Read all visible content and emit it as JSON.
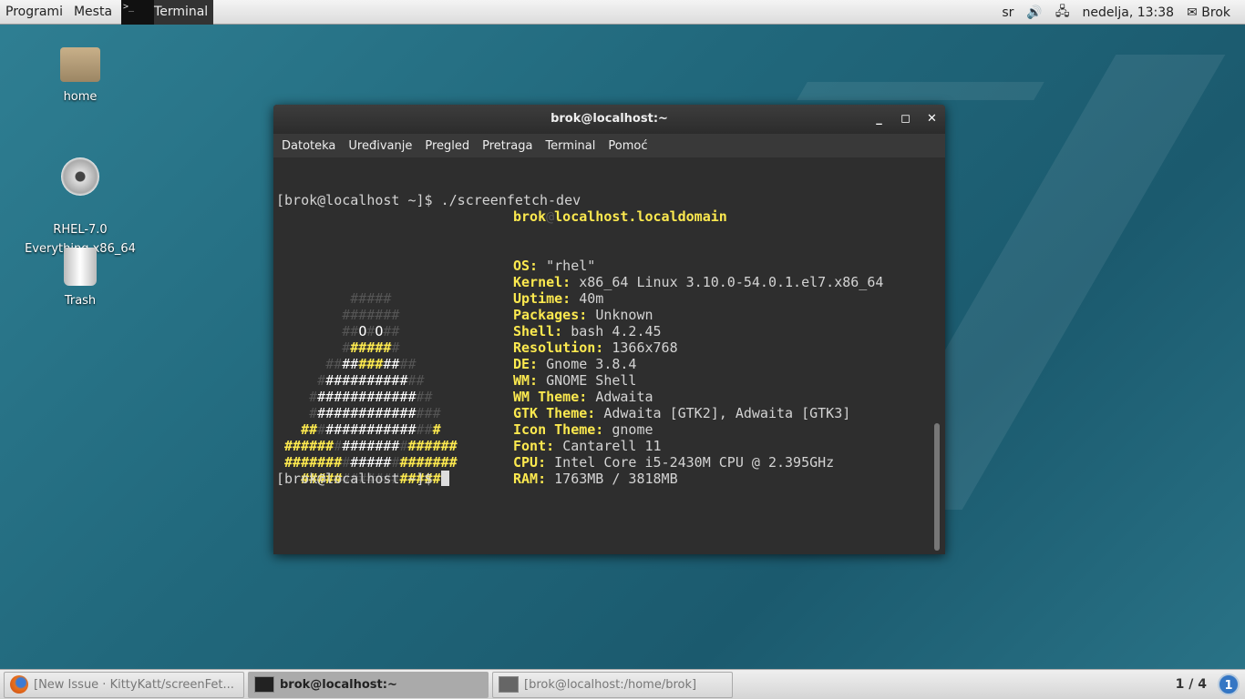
{
  "topbar": {
    "applications": "Programi",
    "places": "Mesta",
    "active_app": "Terminal",
    "keyboard": "sr",
    "clock": "nedelja, 13:38",
    "user": "Brok"
  },
  "desktop": [
    {
      "label": "home"
    },
    {
      "label": "RHEL-7.0\nEverything.x86_64"
    },
    {
      "label": "Trash"
    }
  ],
  "window": {
    "title": "brok@localhost:~",
    "menu": [
      "Datoteka",
      "Uređivanje",
      "Pregled",
      "Pretraga",
      "Terminal",
      "Pomoć"
    ],
    "command_line": "[brok@localhost ~]$ ./screenfetch-dev",
    "prompt": "[brok@localhost ~]$ ",
    "user": "brok",
    "host": "localhost.localdomain",
    "info": [
      [
        "OS:",
        "\"rhel\""
      ],
      [
        "Kernel:",
        "x86_64 Linux 3.10.0-54.0.1.el7.x86_64"
      ],
      [
        "Uptime:",
        "40m"
      ],
      [
        "Packages:",
        "Unknown"
      ],
      [
        "Shell:",
        "bash 4.2.45"
      ],
      [
        "Resolution:",
        "1366x768"
      ],
      [
        "DE:",
        "Gnome 3.8.4"
      ],
      [
        "WM:",
        "GNOME Shell"
      ],
      [
        "WM Theme:",
        "Adwaita"
      ],
      [
        "GTK Theme:",
        "Adwaita [GTK2], Adwaita [GTK3]"
      ],
      [
        "Icon Theme:",
        "gnome"
      ],
      [
        "Font:",
        "Cantarell 11"
      ],
      [
        "CPU:",
        "Intel Core i5-2430M CPU @ 2.395GHz"
      ],
      [
        "RAM:",
        "1763MB / 3818MB"
      ]
    ],
    "ascii": [
      [
        [
          "s",
          "         "
        ],
        [
          "d",
          "#####"
        ]
      ],
      [
        [
          "s",
          "        "
        ],
        [
          "d",
          "#######"
        ]
      ],
      [
        [
          "s",
          "        "
        ],
        [
          "d",
          "##"
        ],
        [
          "w",
          "O"
        ],
        [
          "d",
          "#"
        ],
        [
          "w",
          "O"
        ],
        [
          "d",
          "##"
        ]
      ],
      [
        [
          "s",
          "        "
        ],
        [
          "d",
          "#"
        ],
        [
          "y",
          "#####"
        ],
        [
          "d",
          "#"
        ]
      ],
      [
        [
          "s",
          "      "
        ],
        [
          "d",
          "##"
        ],
        [
          "w",
          "##"
        ],
        [
          "y",
          "###"
        ],
        [
          "w",
          "##"
        ],
        [
          "d",
          "##"
        ]
      ],
      [
        [
          "s",
          "     "
        ],
        [
          "d",
          "#"
        ],
        [
          "w",
          "##########"
        ],
        [
          "d",
          "##"
        ]
      ],
      [
        [
          "s",
          "    "
        ],
        [
          "d",
          "#"
        ],
        [
          "w",
          "############"
        ],
        [
          "d",
          "##"
        ]
      ],
      [
        [
          "s",
          "    "
        ],
        [
          "d",
          "#"
        ],
        [
          "w",
          "############"
        ],
        [
          "d",
          "###"
        ]
      ],
      [
        [
          "s",
          "   "
        ],
        [
          "y",
          "##"
        ],
        [
          "d",
          "#"
        ],
        [
          "w",
          "###########"
        ],
        [
          "d",
          "##"
        ],
        [
          "y",
          "#"
        ]
      ],
      [
        [
          "s",
          " "
        ],
        [
          "y",
          "######"
        ],
        [
          "d",
          "#"
        ],
        [
          "w",
          "#######"
        ],
        [
          "d",
          "#"
        ],
        [
          "y",
          "######"
        ]
      ],
      [
        [
          "s",
          " "
        ],
        [
          "y",
          "#######"
        ],
        [
          "d",
          "#"
        ],
        [
          "w",
          "#####"
        ],
        [
          "d",
          "#"
        ],
        [
          "y",
          "#######"
        ]
      ],
      [
        [
          "s",
          "   "
        ],
        [
          "y",
          "#####"
        ],
        [
          "d",
          "#######"
        ],
        [
          "y",
          "#####"
        ]
      ]
    ]
  },
  "taskbar": {
    "tasks": [
      "[New Issue · KittyKatt/screenFet...",
      "brok@localhost:~",
      "[brok@localhost:/home/brok]"
    ],
    "workspace": "1 / 4",
    "notifications": "1"
  }
}
